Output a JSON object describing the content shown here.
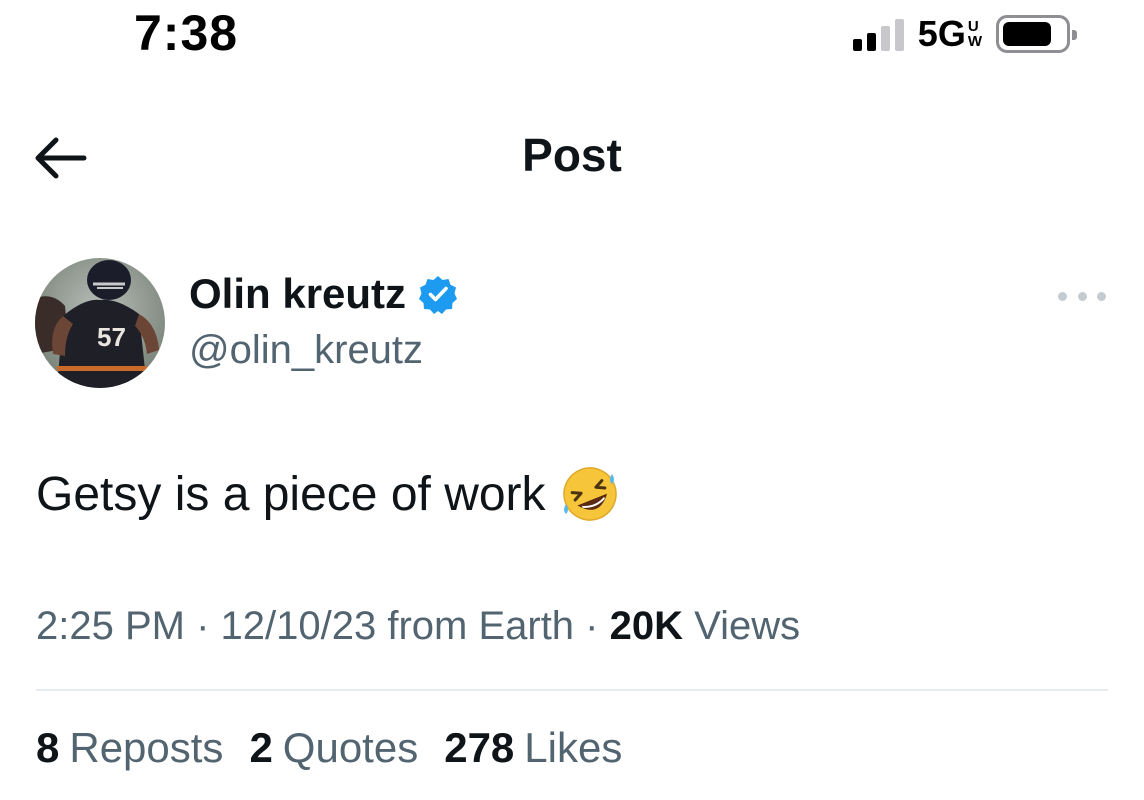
{
  "status_bar": {
    "time": "7:38",
    "network": "5G",
    "network_suffix_top": "U",
    "network_suffix_bottom": "W",
    "battery_level": 0.8
  },
  "header": {
    "title": "Post"
  },
  "author": {
    "name": "Olin kreutz",
    "handle": "@olin_kreutz",
    "verified": true,
    "verified_color": "#1d9bf0"
  },
  "post": {
    "text": "Getsy is a piece of work",
    "emoji": "rolling-on-the-floor-laughing"
  },
  "meta": {
    "time": "2:25 PM",
    "separator": " · ",
    "date": "12/10/23",
    "location": " from Earth",
    "views_count": "20K",
    "views_label": " Views"
  },
  "stats": {
    "reposts_count": "8",
    "reposts_label": "Reposts",
    "quotes_count": "2",
    "quotes_label": "Quotes",
    "likes_count": "278",
    "likes_label": "Likes"
  },
  "colors": {
    "text_primary": "#0f1419",
    "text_secondary": "#536471",
    "divider": "#e6ebef"
  }
}
